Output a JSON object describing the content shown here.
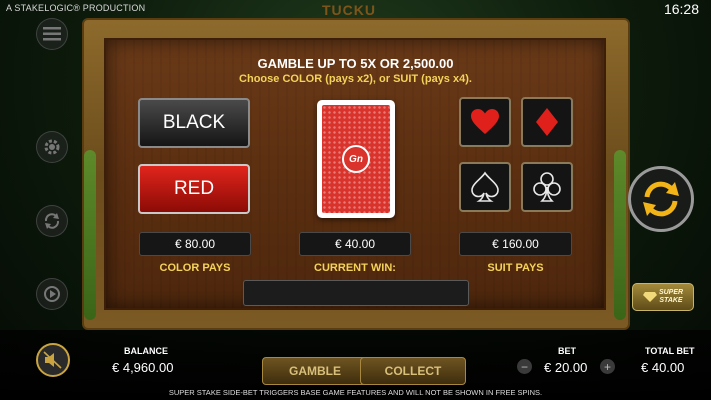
{
  "header": {
    "production": "A STAKELOGIC® PRODUCTION",
    "clock": "16:28",
    "game_logo_fragment": "TUCKU"
  },
  "gamble": {
    "heading": "GAMBLE UP TO 5X OR  2,500.00",
    "subheading": "Choose COLOR (pays x2), or SUIT (pays x4).",
    "color_buttons": {
      "black": "BLACK",
      "red": "RED"
    },
    "card_logo": "Gn",
    "suits": [
      "hearts",
      "diamonds",
      "spades",
      "clubs"
    ],
    "color_pays": {
      "value": "€ 80.00",
      "label": "COLOR PAYS"
    },
    "current_win": {
      "value": "€ 40.00",
      "label": "CURRENT WIN:"
    },
    "suit_pays": {
      "value": "€ 160.00",
      "label": "SUIT PAYS"
    }
  },
  "side_controls": {
    "icons": [
      "menu-icon",
      "settings-icon",
      "autoplay-icon",
      "turbo-icon"
    ]
  },
  "super_stake": {
    "line1": "SUPER",
    "line2": "STAKE"
  },
  "footer": {
    "balance_label": "BALANCE",
    "balance_value": "€ 4,960.00",
    "gamble_label": "GAMBLE",
    "collect_label": "COLLECT",
    "bet_label": "BET",
    "bet_value": "€ 20.00",
    "bet_minus": "−",
    "bet_plus": "+",
    "total_bet_label": "TOTAL BET",
    "total_bet_value": "€ 40.00",
    "disclaimer": "SUPER STAKE SIDE-BET TRIGGERS BASE GAME FEATURES AND WILL NOT BE SHOWN IN FREE SPINS."
  },
  "colors": {
    "gold_text": "#f4d35a",
    "red_button": "#e0251c",
    "board_wood": "#5a2e10"
  }
}
